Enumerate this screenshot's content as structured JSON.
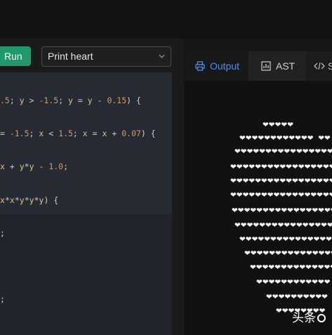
{
  "toolbar": {
    "run_label": "Run",
    "example_select_value": "Print heart"
  },
  "editor": {
    "lines": [
      [
        "",
        ".5; y > -1.5; y = y - 0.15) {"
      ],
      [
        "",
        "= -1.5; x < 1.5; x = x + 0.07) {"
      ],
      [
        "",
        "x + y*y - 1.0;"
      ],
      [
        "",
        "x*x*y*y*y) {"
      ],
      [
        "",
        ";"
      ],
      [
        "",
        ""
      ],
      [
        "",
        ";"
      ]
    ]
  },
  "output_panel": {
    "tabs": [
      {
        "label": "Output",
        "icon": "printer-icon",
        "active": true
      },
      {
        "label": "AST",
        "icon": "chart-icon",
        "active": false
      },
      {
        "label": "S",
        "icon": "code-icon",
        "active": false
      }
    ],
    "heart_rows": [
      "❤❤❤❤❤",
      "❤❤❤❤❤❤❤❤❤❤❤❤  ❤❤",
      "❤❤❤❤❤❤❤❤❤❤❤❤❤❤❤❤❤",
      "❤❤❤❤❤❤❤❤❤❤❤❤❤❤❤❤❤❤❤",
      "❤❤❤❤❤❤❤❤❤❤❤❤❤❤❤❤❤❤❤",
      "❤❤❤❤❤❤❤❤❤❤❤❤❤❤❤❤❤❤❤",
      "❤❤❤❤❤❤❤❤❤❤❤❤❤❤❤❤❤❤❤",
      "❤❤❤❤❤❤❤❤❤❤❤❤❤❤❤❤❤❤",
      "❤❤❤❤❤❤❤❤❤❤❤❤❤❤❤❤❤",
      "❤❤❤❤❤❤❤❤❤❤❤❤❤❤❤❤",
      "❤❤❤❤❤❤❤❤❤❤❤❤❤❤",
      "❤❤❤❤❤❤❤❤❤❤❤❤",
      "❤❤❤❤❤❤❤❤❤❤",
      "❤❤❤❤❤❤❤❤"
    ]
  },
  "watermark": {
    "text": "头条"
  }
}
